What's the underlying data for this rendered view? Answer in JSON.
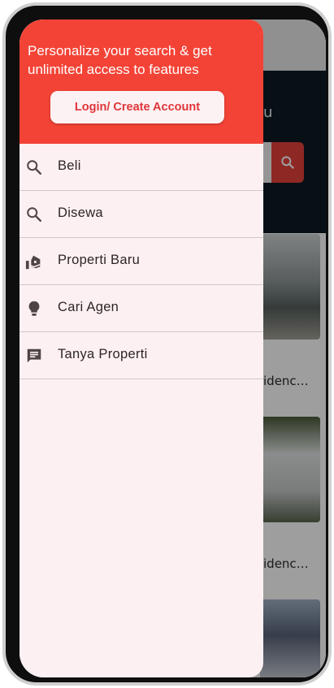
{
  "drawer": {
    "promo_text": "Personalize your search & get unlimited access to features",
    "login_button": "Login/ Create Account",
    "items": [
      {
        "label": "Beli",
        "icon": "search-icon"
      },
      {
        "label": "Disewa",
        "icon": "search-icon"
      },
      {
        "label": "Properti Baru",
        "icon": "home-hand-icon"
      },
      {
        "label": "Cari Agen",
        "icon": "lightbulb-icon"
      },
      {
        "label": "Tanya Properti",
        "icon": "chat-icon"
      }
    ]
  },
  "background": {
    "hero_text_fragment": "u",
    "captions": [
      "idenc…",
      "idenc…"
    ]
  },
  "colors": {
    "accent": "#f34336",
    "drawer_bg": "#fcf0f2",
    "login_text": "#e0353a"
  }
}
